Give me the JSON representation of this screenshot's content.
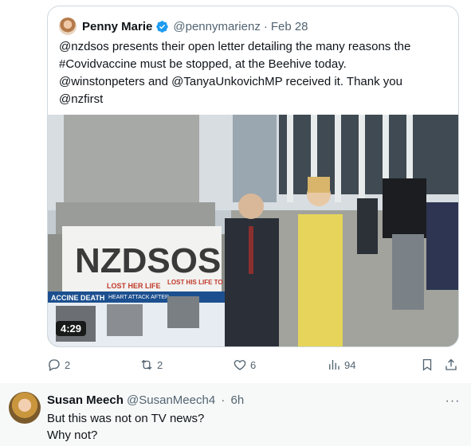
{
  "quoted_tweet": {
    "author_name": "Penny Marie",
    "handle": "@pennymarienz",
    "separator": "·",
    "date": "Feb 28",
    "text_lines": [
      "@nzdsos presents their open letter detailing the many reasons the",
      "#Covidvaccine must be stopped, at the Beehive today.",
      "@winstonpeters and @TanyaUnkovichMP received it. Thank you",
      "@nzfirst"
    ],
    "media": {
      "duration": "4:29",
      "banner_text": "NZDSOS",
      "poster_texts": [
        "ACCINE DEATH",
        "LOST HER LIFE",
        "LOST HIS LIFE TO",
        "HEART ATTACK AFTER"
      ]
    }
  },
  "actions": {
    "reply_count": "2",
    "repost_count": "2",
    "like_count": "6",
    "view_count": "94"
  },
  "reply": {
    "author_name": "Susan Meech",
    "handle": "@SusanMeech4",
    "separator": "·",
    "time": "6h",
    "text_lines": [
      "But this was not on TV news?",
      "Why not?"
    ],
    "more_label": "···"
  },
  "colors": {
    "text_primary": "#0f1419",
    "text_secondary": "#536471",
    "border": "#cfd9de",
    "verified": "#1d9bf0",
    "reply_background": "#f7f9f9"
  }
}
